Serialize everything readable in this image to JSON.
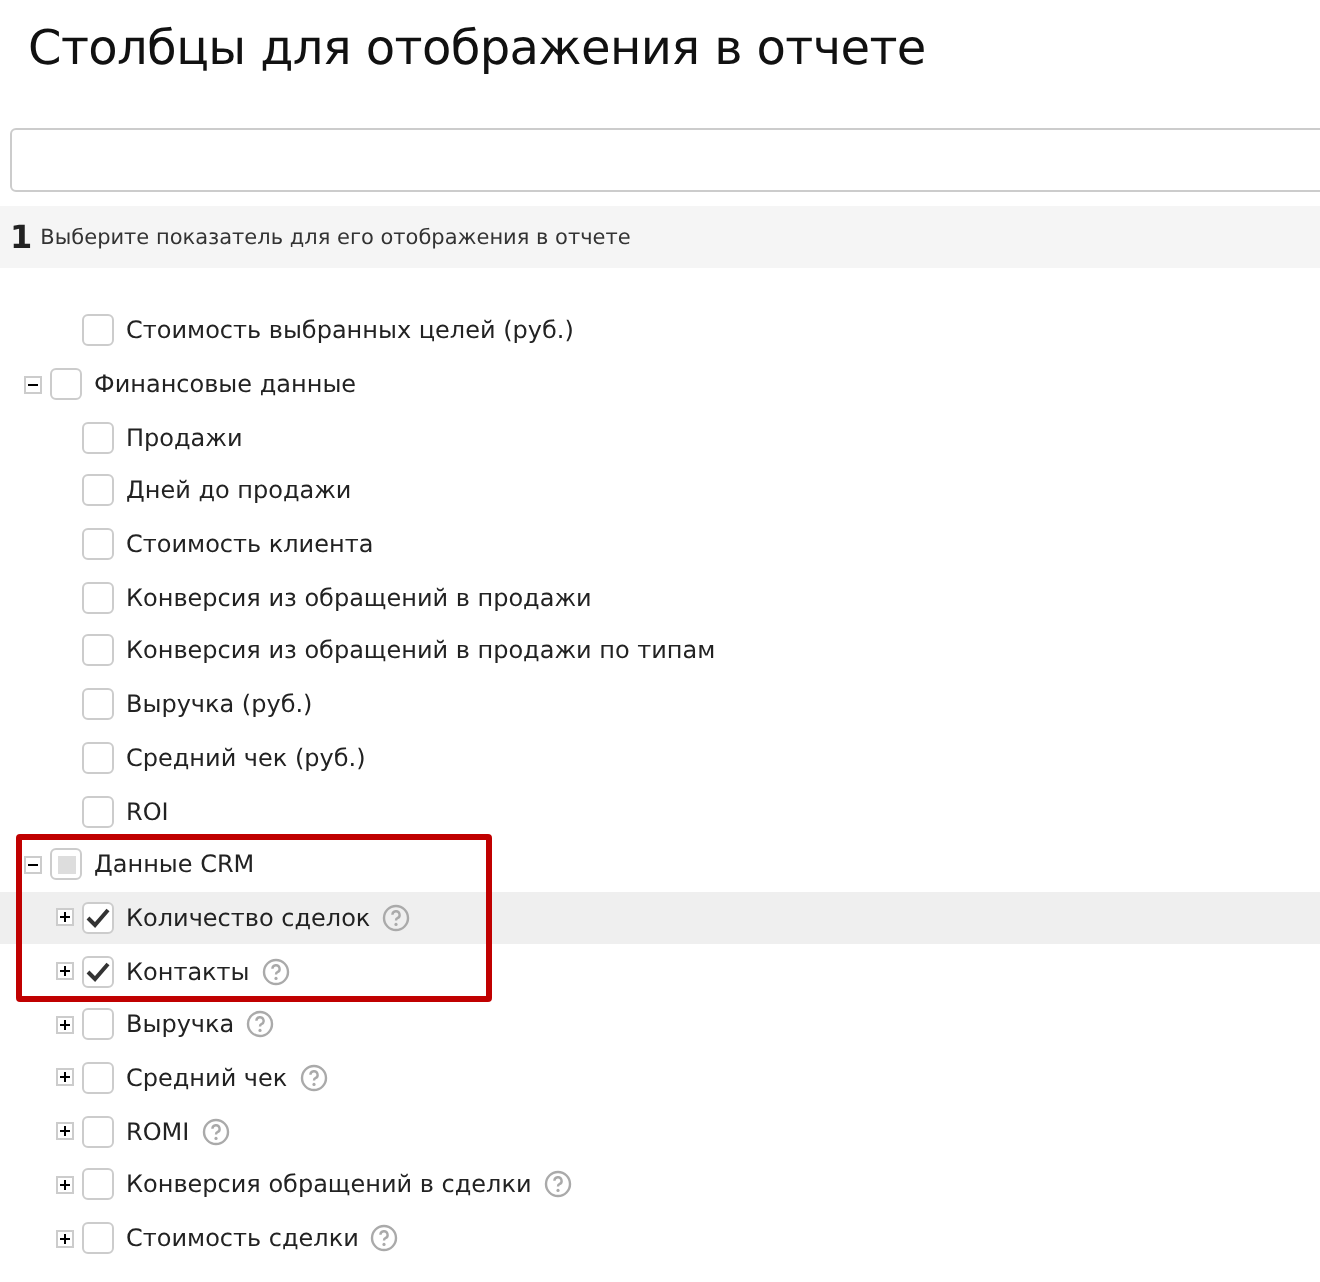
{
  "title": "Столбцы для отображения в отчете",
  "step": {
    "number": "1",
    "text": "Выберите показатель для его отображения в отчете"
  },
  "tree": [
    {
      "children": [
        {
          "label": "Стоимость выбранных целей (руб.)",
          "checked": false
        }
      ]
    },
    {
      "label": "Финансовые данные",
      "checked": false,
      "expanded": true,
      "children": [
        {
          "label": "Продажи",
          "checked": false
        },
        {
          "label": "Дней до продажи",
          "checked": false
        },
        {
          "label": "Стоимость клиента",
          "checked": false
        },
        {
          "label": "Конверсия из обращений в продажи",
          "checked": false
        },
        {
          "label": "Конверсия из обращений в продажи по типам",
          "checked": false
        },
        {
          "label": "Выручка (руб.)",
          "checked": false
        },
        {
          "label": "Средний чек (руб.)",
          "checked": false
        },
        {
          "label": "ROI",
          "checked": false
        }
      ]
    },
    {
      "label": "Данные CRM",
      "checked": false,
      "indeterminate": true,
      "expanded": true,
      "outlined": true,
      "children": [
        {
          "label": "Количество сделок",
          "checked": true,
          "expanded": false,
          "help": true,
          "highlighted": true,
          "outlined": true
        },
        {
          "label": "Контакты",
          "checked": true,
          "expanded": false,
          "help": true,
          "outlined": true
        },
        {
          "label": "Выручка",
          "checked": false,
          "expanded": false,
          "help": true
        },
        {
          "label": "Средний чек",
          "checked": false,
          "expanded": false,
          "help": true
        },
        {
          "label": "ROMI",
          "checked": false,
          "expanded": false,
          "help": true
        },
        {
          "label": "Конверсия обращений в сделки",
          "checked": false,
          "expanded": false,
          "help": true
        },
        {
          "label": "Стоимость сделки",
          "checked": false,
          "expanded": false,
          "help": true
        }
      ]
    }
  ]
}
